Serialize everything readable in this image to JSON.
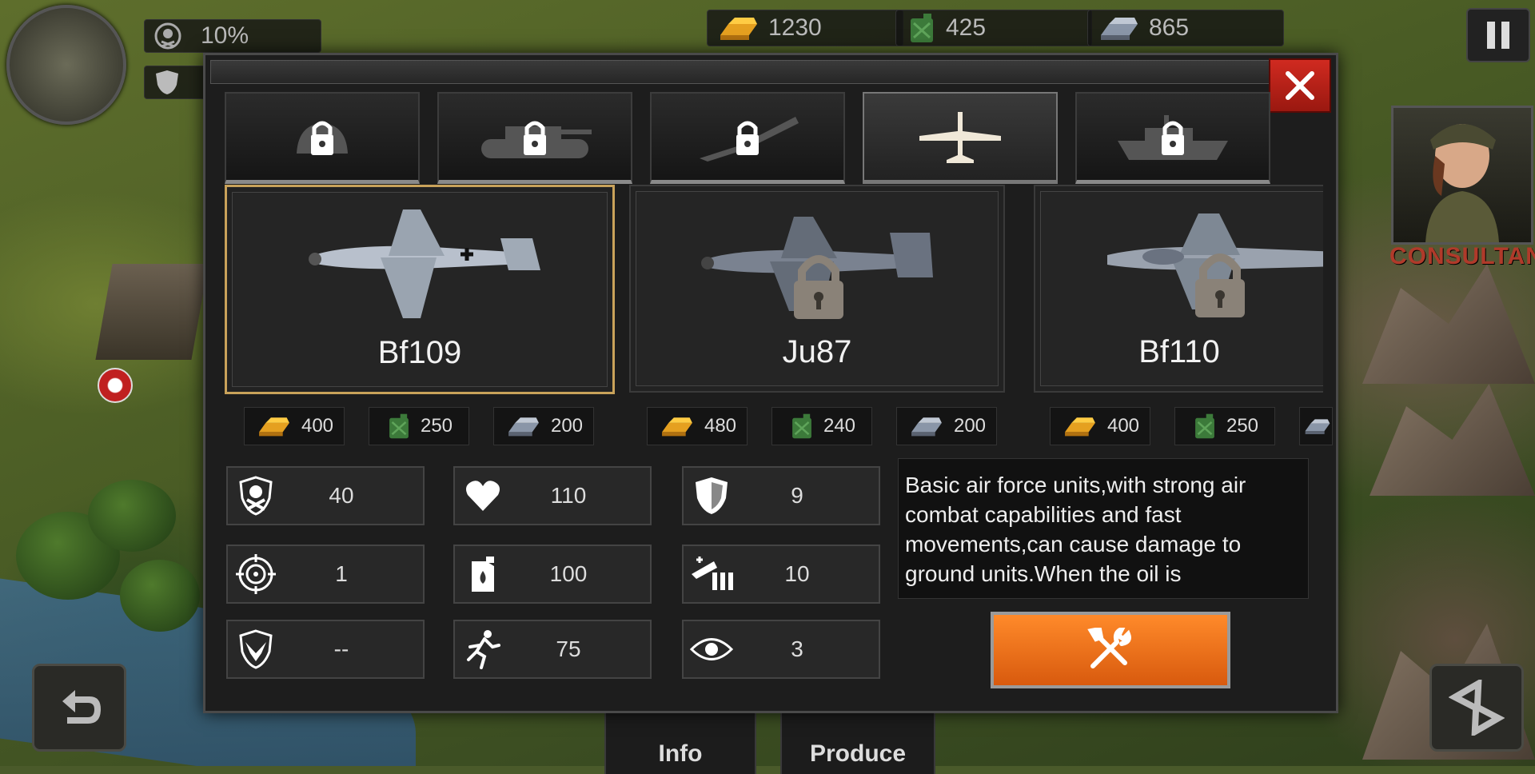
{
  "hud": {
    "morale_pct": "10%",
    "gold": "1230",
    "oil": "425",
    "steel": "865",
    "consultant_label": "CONSULTANT"
  },
  "bottom_tabs": {
    "info": "Info",
    "produce": "Produce"
  },
  "dialog": {
    "categories": [
      {
        "name": "infantry",
        "locked": true
      },
      {
        "name": "tank",
        "locked": true
      },
      {
        "name": "artillery",
        "locked": true
      },
      {
        "name": "aircraft",
        "locked": false,
        "active": true
      },
      {
        "name": "navy",
        "locked": true
      }
    ],
    "units": [
      {
        "name": "Bf109",
        "locked": false,
        "selected": true,
        "gold": "400",
        "oil": "250",
        "steel": "200"
      },
      {
        "name": "Ju87",
        "locked": true,
        "selected": false,
        "gold": "480",
        "oil": "240",
        "steel": "200"
      },
      {
        "name": "Bf110",
        "locked": true,
        "selected": false,
        "gold": "400",
        "oil": "250",
        "steel": ""
      }
    ],
    "stats": {
      "attack": "40",
      "health": "110",
      "defense": "9",
      "range": "1",
      "fuel": "100",
      "ammo": "10",
      "anti_air": "--",
      "movement": "75",
      "vision": "3"
    },
    "description": "Basic air force units,with strong air combat capabilities and fast movements,can cause damage to ground units.When the oil is"
  },
  "colors": {
    "accent_orange": "#e8701a",
    "close_red": "#c0221a",
    "selected_border": "#c9a25a"
  }
}
